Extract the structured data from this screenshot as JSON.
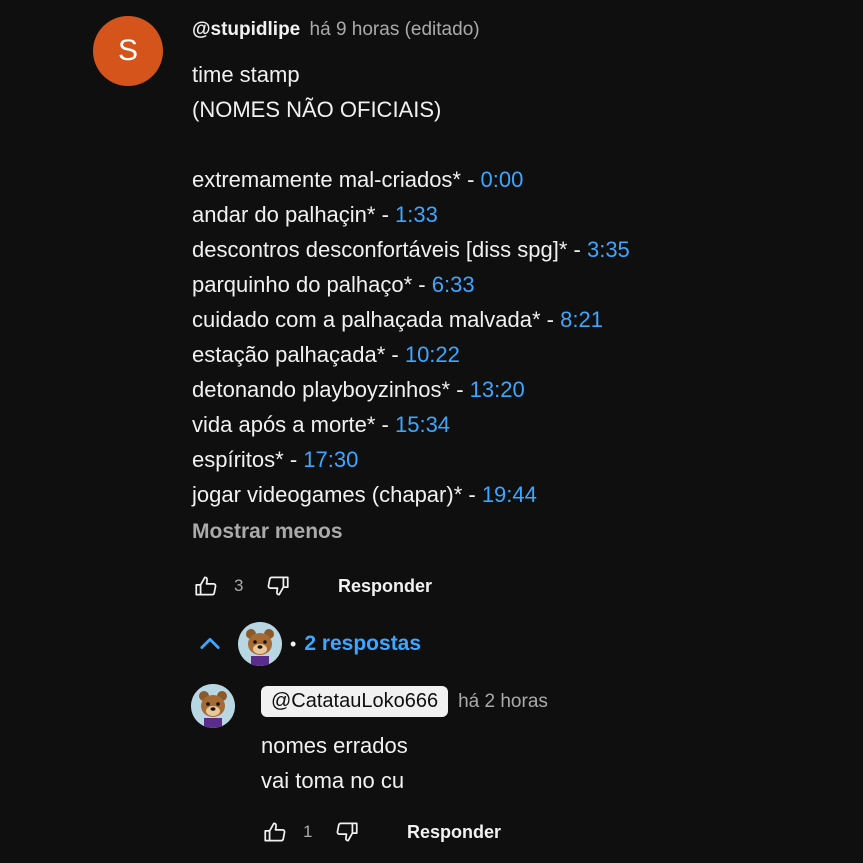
{
  "comment": {
    "avatar_letter": "S",
    "author": "@stupidlipe",
    "time": "há 9 horas (editado)",
    "lines": [
      "time stamp",
      "(NOMES NÃO OFICIAIS)"
    ],
    "tracks": [
      {
        "title": "extremamente mal-criados* - ",
        "time": "0:00"
      },
      {
        "title": "andar do palhaçin* - ",
        "time": "1:33"
      },
      {
        "title": "descontros desconfortáveis [diss spg]* - ",
        "time": "3:35"
      },
      {
        "title": "parquinho do palhaço* - ",
        "time": "6:33"
      },
      {
        "title": "cuidado com a palhaçada malvada* - ",
        "time": "8:21"
      },
      {
        "title": "estação palhaçada* - ",
        "time": "10:22"
      },
      {
        "title": "detonando playboyzinhos* - ",
        "time": "13:20"
      },
      {
        "title": "vida após a morte* - ",
        "time": "15:34"
      },
      {
        "title": "espíritos* - ",
        "time": "17:30"
      },
      {
        "title": "jogar videogames (chapar)* - ",
        "time": "19:44"
      }
    ],
    "show_less": "Mostrar menos",
    "likes": "3",
    "reply_label": "Responder"
  },
  "replies": {
    "toggle_label": "2 respostas",
    "dot": "•"
  },
  "reply": {
    "author": "@CatatauLoko666",
    "time": "há 2 horas",
    "lines": [
      "nomes errados",
      "vai toma no cu"
    ],
    "likes": "1",
    "reply_label": "Responder"
  },
  "colors": {
    "accent": "#3ea6ff",
    "avatar": "#d4541c",
    "background": "#0f0f0f"
  }
}
